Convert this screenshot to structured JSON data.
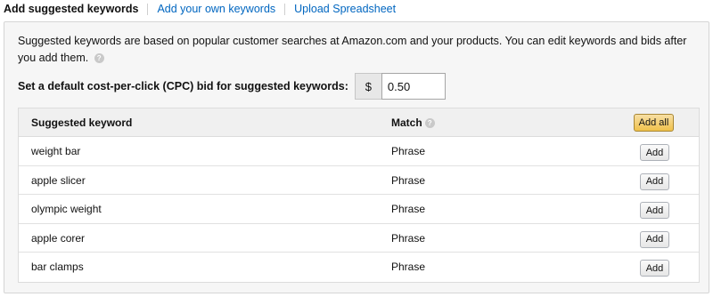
{
  "tabs": [
    {
      "label": "Add suggested keywords"
    },
    {
      "label": "Add your own keywords"
    },
    {
      "label": "Upload Spreadsheet"
    }
  ],
  "intro": {
    "text": "Suggested keywords are based on popular customer searches at Amazon.com and your products. You can edit keywords and bids after you add them.",
    "help_icon": "question-circle-icon"
  },
  "bid": {
    "label": "Set a default cost-per-click (CPC) bid for suggested keywords:",
    "currency": "$",
    "value": "0.50"
  },
  "table": {
    "headers": {
      "keyword": "Suggested keyword",
      "match": "Match",
      "match_help_icon": "question-circle-icon",
      "add_all": "Add all"
    },
    "rows": [
      {
        "keyword": "weight bar",
        "match": "Phrase",
        "action": "Add"
      },
      {
        "keyword": "apple slicer",
        "match": "Phrase",
        "action": "Add"
      },
      {
        "keyword": "olympic weight",
        "match": "Phrase",
        "action": "Add"
      },
      {
        "keyword": "apple corer",
        "match": "Phrase",
        "action": "Add"
      },
      {
        "keyword": "bar clamps",
        "match": "Phrase",
        "action": "Add"
      }
    ]
  },
  "colors": {
    "link": "#0066c0",
    "panel_bg": "#f6f6f6",
    "add_all_button": "#f0c14b"
  }
}
